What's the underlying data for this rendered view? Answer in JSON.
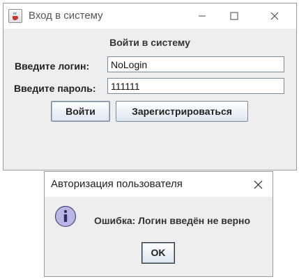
{
  "main_window": {
    "title": "Вход в систему",
    "heading": "Войти в систему",
    "login_label": "Введите логин:",
    "login_value": "NoLogin",
    "password_label": "Введите пароль:",
    "password_value": "111111",
    "login_button": "Войти",
    "register_button": "Зарегистрироваться",
    "icons": {
      "app": "java-cup-icon",
      "minimize": "minimize-icon",
      "maximize": "maximize-icon",
      "close": "close-icon"
    }
  },
  "dialog": {
    "title": "Авторизация пользователя",
    "message": "Ошибка: Логин введён не верно",
    "ok_button": "OK",
    "icons": {
      "info": "info-icon",
      "close": "close-icon"
    }
  },
  "colors": {
    "window_bg": "#eeeeee",
    "titlebar_bg": "#ffffff",
    "button_gradient_end": "#dde6f0",
    "info_icon_fill": "#b9b6e6"
  }
}
